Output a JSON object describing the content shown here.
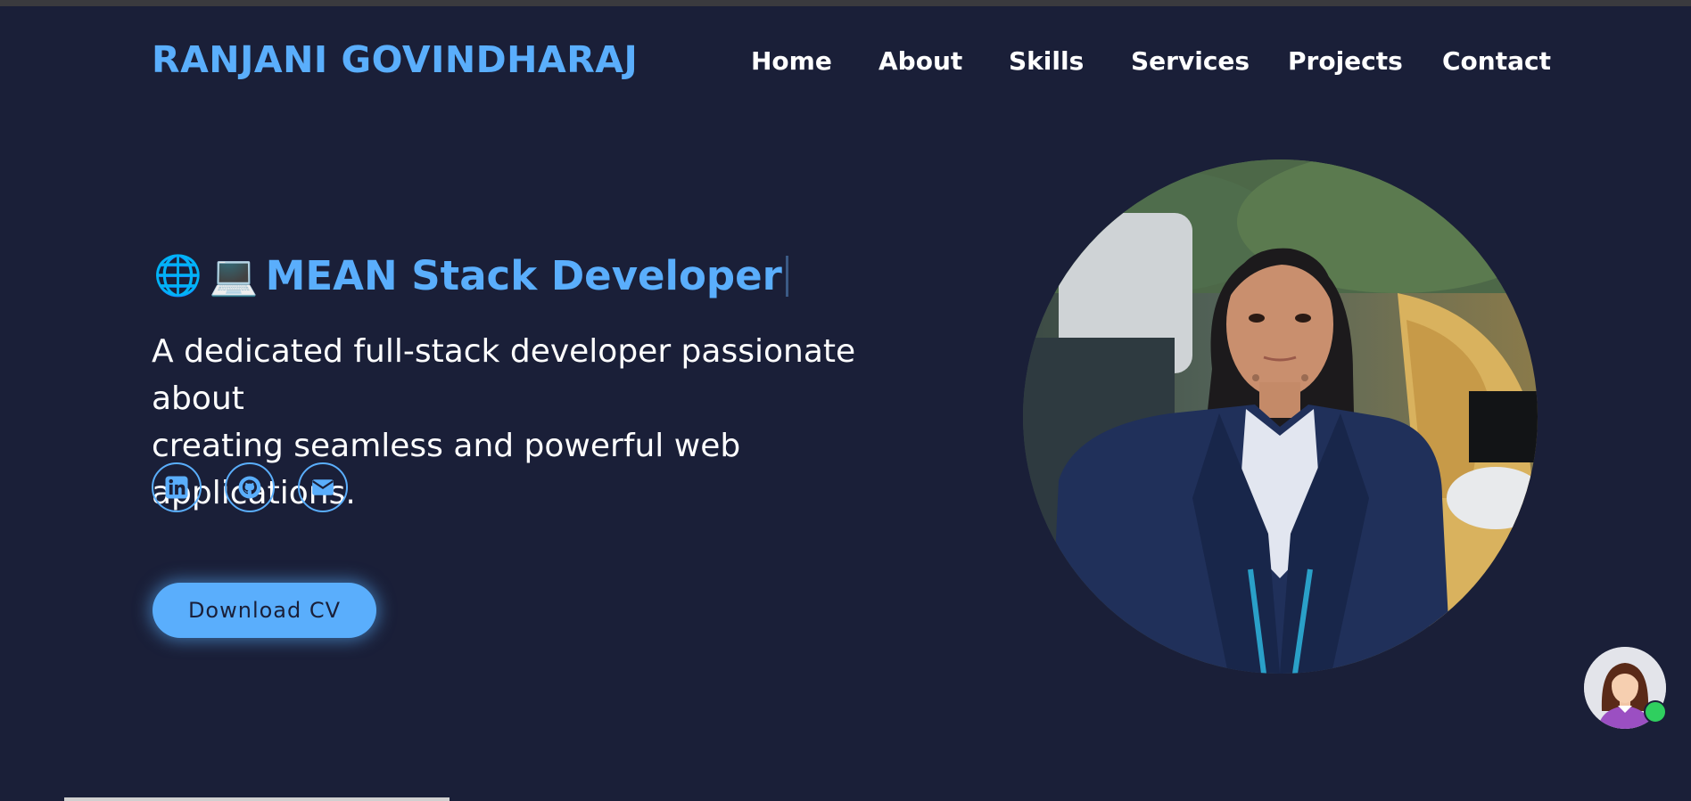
{
  "header": {
    "brand": "RANJANI GOVINDHARAJ",
    "nav": [
      "Home",
      "About",
      "Skills",
      "Services",
      "Projects",
      "Contact"
    ]
  },
  "hero": {
    "emoji_globe": "🌐",
    "emoji_laptop": "💻",
    "title": "MEAN Stack Developer",
    "description_line1": "A dedicated full-stack developer passionate about",
    "description_line2": "creating seamless and powerful web applications.",
    "socials": [
      "linkedin-icon",
      "github-icon",
      "envelope-icon"
    ],
    "cv_button": "Download CV"
  },
  "colors": {
    "background": "#1a1f38",
    "accent": "#5aaefc",
    "text": "#ffffff",
    "online": "#2fcf5f"
  }
}
